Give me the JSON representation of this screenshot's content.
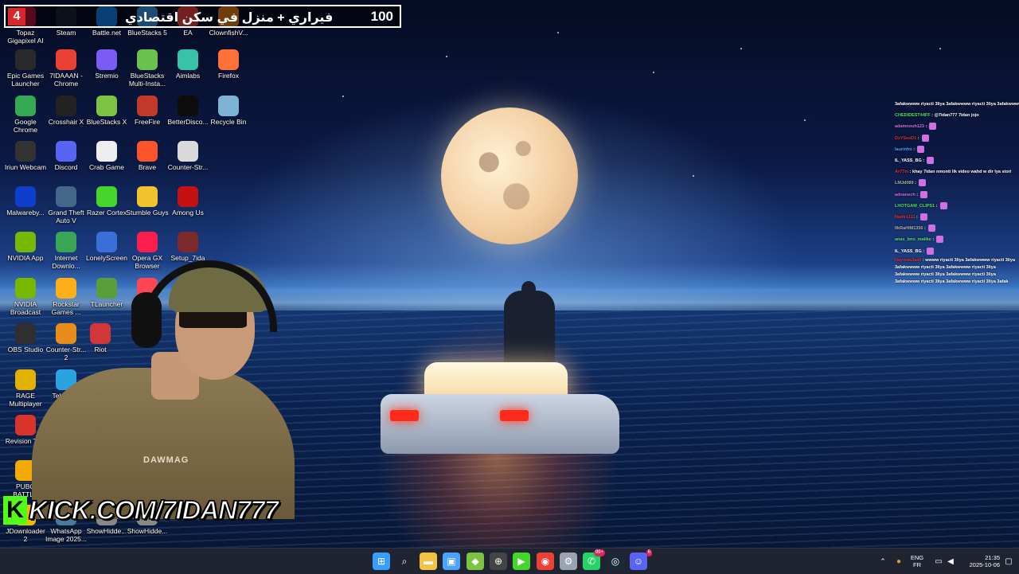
{
  "banner": {
    "count": "4",
    "text": "فيراري + منزل في سكن اقتصادي",
    "goal": "100"
  },
  "desktop_icons": [
    {
      "label": "Topaz Gigapixel AI",
      "icon": "topaz-gigapixel-icon",
      "color": "#c2183b"
    },
    {
      "label": "Steam",
      "icon": "steam-icon",
      "color": "#1b2838"
    },
    {
      "label": "Battle.net",
      "icon": "battlenet-icon",
      "color": "#148eff"
    },
    {
      "label": "BlueStacks 5",
      "icon": "bluestacks-icon",
      "color": "#3ea6ff"
    },
    {
      "label": "EA",
      "icon": "ea-icon",
      "color": "#ff4747"
    },
    {
      "label": "ClownfishV...",
      "icon": "clownfish-icon",
      "color": "#f28c1c"
    },
    {
      "label": "Epic Games Launcher",
      "icon": "epic-games-icon",
      "color": "#2a2a2a"
    },
    {
      "label": "7IDAAAN - Chrome",
      "icon": "chrome-icon",
      "color": "#e94235"
    },
    {
      "label": "Stremio",
      "icon": "stremio-icon",
      "color": "#7b5bf5"
    },
    {
      "label": "BlueStacks Multi-Insta...",
      "icon": "bluestacks-multi-icon",
      "color": "#6ac14b"
    },
    {
      "label": "Aimlabs",
      "icon": "aimlabs-icon",
      "color": "#36c3a8"
    },
    {
      "label": "Firefox",
      "icon": "firefox-icon",
      "color": "#ff7139"
    },
    {
      "label": "Google Chrome",
      "icon": "chrome-icon",
      "color": "#34a853"
    },
    {
      "label": "Crosshair X",
      "icon": "crosshair-icon",
      "color": "#222222"
    },
    {
      "label": "BlueStacks X",
      "icon": "bluestacks-x-icon",
      "color": "#7cc341"
    },
    {
      "label": "FreeFire",
      "icon": "freefire-icon",
      "color": "#c0392b"
    },
    {
      "label": "BetterDisco...",
      "icon": "betterdiscord-icon",
      "color": "#0c0c0c"
    },
    {
      "label": "Recycle Bin",
      "icon": "recycle-bin-icon",
      "color": "#7fb3d5"
    },
    {
      "label": "Iriun Webcam",
      "icon": "iriun-icon",
      "color": "#333333"
    },
    {
      "label": "Discord",
      "icon": "discord-icon",
      "color": "#5865f2"
    },
    {
      "label": "Crab Game",
      "icon": "crab-game-icon",
      "color": "#eeeeee"
    },
    {
      "label": "Brave",
      "icon": "brave-icon",
      "color": "#fb542b"
    },
    {
      "label": "Counter-Str...",
      "icon": "counter-strike-icon",
      "color": "#d9d9d9"
    },
    {
      "label": "Malwareby...",
      "icon": "malwarebytes-icon",
      "color": "#0d3ecc"
    },
    {
      "label": "Grand Theft Auto V",
      "icon": "gta-icon",
      "color": "#446688"
    },
    {
      "label": "Razer Cortex",
      "icon": "razer-icon",
      "color": "#44d62c"
    },
    {
      "label": "Stumble Guys",
      "icon": "stumble-guys-icon",
      "color": "#f2c12e"
    },
    {
      "label": "Among Us",
      "icon": "among-us-icon",
      "color": "#c51111"
    },
    {
      "label": "NVIDIA App",
      "icon": "nvidia-icon",
      "color": "#76b900"
    },
    {
      "label": "Internet Downlo...",
      "icon": "idm-icon",
      "color": "#3aa655"
    },
    {
      "label": "LonelyScreen",
      "icon": "lonelyscreen-icon",
      "color": "#3a6fd8"
    },
    {
      "label": "Opera GX Browser",
      "icon": "opera-gx-icon",
      "color": "#fa1e4e"
    },
    {
      "label": "Setup_7ida",
      "icon": "setup-icon",
      "color": "#7a2a2a"
    },
    {
      "label": "NVIDIA Broadcast",
      "icon": "nvidia-broadcast-icon",
      "color": "#76b900"
    },
    {
      "label": "Rockstar Games ...",
      "icon": "rockstar-icon",
      "color": "#fcaf17"
    },
    {
      "label": "TLauncher",
      "icon": "tlauncher-icon",
      "color": "#5a9e3a"
    },
    {
      "label": "VALO...",
      "icon": "valorant-icon",
      "color": "#ff4655"
    },
    {
      "label": "OBS Studio",
      "icon": "obs-icon",
      "color": "#302e31"
    },
    {
      "label": "Counter-Str... 2",
      "icon": "counter-strike2-icon",
      "color": "#e88c1c"
    },
    {
      "label": "Riot",
      "icon": "riot-icon",
      "color": "#d13639"
    },
    {
      "label": "RAGE Multiplayer",
      "icon": "rage-mp-icon",
      "color": "#e2b100"
    },
    {
      "label": "Telegram",
      "icon": "telegram-icon",
      "color": "#2aa3e0"
    },
    {
      "label": "Revision Tool",
      "icon": "revision-tool-icon",
      "color": "#d9342b"
    },
    {
      "label": "PUBG BATTLE",
      "icon": "pubg-icon",
      "color": "#f2a900"
    },
    {
      "label": "JDownloader 2",
      "icon": "jdownloader-icon",
      "color": "#f5b800"
    },
    {
      "label": "WhatsApp Image 2025...",
      "icon": "image-file-icon",
      "color": "#4a7a9b"
    },
    {
      "label": "ShowHidde...",
      "icon": "script-icon",
      "color": "#888888"
    },
    {
      "label": "ShowHidde...",
      "icon": "script-icon",
      "color": "#888888"
    }
  ],
  "chat": {
    "header": "3afakwwww riyacti 3liya 3afakwwww riyacti 3liya 3afakwwww",
    "lines": [
      {
        "user": "CHEDIDEST44FF",
        "msg": ": @7idan777 7idan jojo",
        "color": "#52e06a"
      },
      {
        "user": "adamnouh123",
        "msg": ":",
        "color": "#d070e0"
      },
      {
        "user": "DzYSeeD1",
        "msg": ":",
        "color": "#e0302a"
      },
      {
        "user": "laurinho",
        "msg": ":",
        "color": "#4da6ff"
      },
      {
        "user": "IL_YASS_BG",
        "msg": ":",
        "color": "#ffffff"
      },
      {
        "user": "Ar77m",
        "msg": ": khay 7idan nmonti lik video wahd w dir lya stori",
        "color": "#e0302a"
      },
      {
        "user": "LMJd089",
        "msg": ":",
        "color": "#b0b0b0"
      },
      {
        "user": "adnanech",
        "msg": ":",
        "color": "#d070e0"
      },
      {
        "user": "LHOTGAM_CLIPS1",
        "msg": ":",
        "color": "#52e06a"
      },
      {
        "user": "Nadir1111",
        "msg": ":",
        "color": "#e0302a"
      },
      {
        "user": "IlkRaHIM1356",
        "msg": ":",
        "color": "#b0b0b0"
      },
      {
        "user": "anas_bno_malike",
        "msg": ":",
        "color": "#52e06a"
      },
      {
        "user": "IL_YASS_BG",
        "msg": ":",
        "color": "#ffffff"
      }
    ],
    "long_msg_user": "Naymaa3aa9",
    "long_msg": ": wwww riyacti 3liya 3afakwwww riyacti 3liya 3afakwwww riyacti 3liya 3afakwwww riyacti 3liya 3afakwwww riyacti 3liya 3afakwwww riyacti 3liya 3afakwwww riyacti 3liya 3afakwwww riyacti 3liya 3afak"
  },
  "webcam": {
    "shirt_print": "DAWMAG"
  },
  "kick": {
    "k": "K",
    "url": "KICK.COM/7IDAN777"
  },
  "taskbar": {
    "apps": [
      {
        "name": "start-button",
        "icon": "windows-icon"
      },
      {
        "name": "search-button",
        "icon": "search-icon"
      },
      {
        "name": "file-explorer",
        "icon": "folder-icon"
      },
      {
        "name": "microsoft-store",
        "icon": "store-icon"
      },
      {
        "name": "bluestacks-taskbar",
        "icon": "bluestacks-icon"
      },
      {
        "name": "crosshair-taskbar",
        "icon": "crosshair-icon"
      },
      {
        "name": "razer-taskbar",
        "icon": "razer-icon"
      },
      {
        "name": "chrome-taskbar",
        "icon": "chrome-icon"
      },
      {
        "name": "settings-taskbar",
        "icon": "gear-icon"
      },
      {
        "name": "whatsapp-taskbar",
        "icon": "whatsapp-icon",
        "badge": "99+"
      },
      {
        "name": "steam-taskbar",
        "icon": "steam-icon"
      },
      {
        "name": "discord-taskbar",
        "icon": "discord-icon",
        "badge": "6"
      }
    ],
    "lang": "ENG",
    "layout": "FR",
    "time": "21:35",
    "date": "2025-10-06"
  }
}
